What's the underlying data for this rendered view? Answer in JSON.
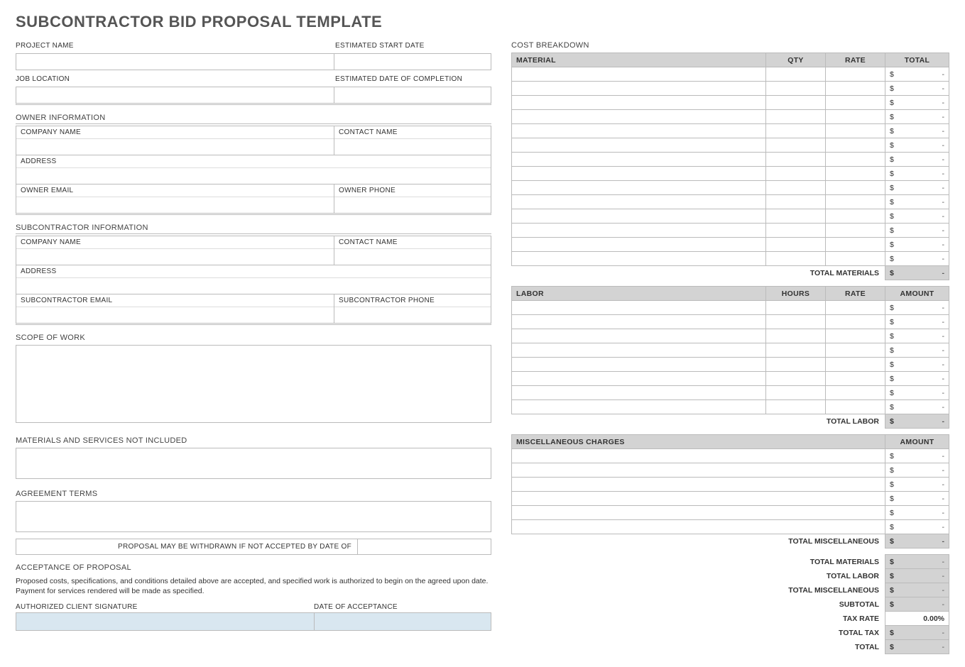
{
  "title": "SUBCONTRACTOR BID PROPOSAL TEMPLATE",
  "left": {
    "project_name_label": "PROJECT NAME",
    "start_date_label": "ESTIMATED START DATE",
    "job_location_label": "JOB LOCATION",
    "completion_label": "ESTIMATED DATE OF COMPLETION",
    "owner_info_label": "OWNER INFORMATION",
    "company_name_label": "COMPANY NAME",
    "contact_name_label": "CONTACT NAME",
    "address_label": "ADDRESS",
    "owner_email_label": "OWNER EMAIL",
    "owner_phone_label": "OWNER PHONE",
    "subcontractor_info_label": "SUBCONTRACTOR INFORMATION",
    "sub_email_label": "SUBCONTRACTOR EMAIL",
    "sub_phone_label": "SUBCONTRACTOR PHONE",
    "scope_label": "SCOPE OF WORK",
    "not_included_label": "MATERIALS AND SERVICES NOT INCLUDED",
    "agreement_label": "AGREEMENT TERMS",
    "proposal_withdraw_label": "PROPOSAL MAY BE WITHDRAWN IF NOT ACCEPTED BY DATE OF",
    "acceptance_label": "ACCEPTANCE OF PROPOSAL",
    "acceptance_text": "Proposed costs, specifications, and conditions detailed above are accepted, and specified work is authorized to begin on the agreed upon date.  Payment for services rendered will be made as specified.",
    "sig_label": "AUTHORIZED CLIENT SIGNATURE",
    "date_accept_label": "DATE OF ACCEPTANCE"
  },
  "right": {
    "cost_breakdown_label": "COST BREAKDOWN",
    "material_header": "MATERIAL",
    "qty_header": "QTY",
    "rate_header": "RATE",
    "total_header": "TOTAL",
    "material_rows": 14,
    "total_materials_label": "TOTAL MATERIALS",
    "labor_header": "LABOR",
    "hours_header": "HOURS",
    "amount_header": "AMOUNT",
    "labor_rows": 8,
    "total_labor_label": "TOTAL LABOR",
    "misc_header": "MISCELLANEOUS CHARGES",
    "misc_rows": 6,
    "total_misc_label": "TOTAL MISCELLANEOUS",
    "summary": {
      "total_materials": "TOTAL MATERIALS",
      "total_labor": "TOTAL LABOR",
      "total_misc": "TOTAL MISCELLANEOUS",
      "subtotal": "SUBTOTAL",
      "tax_rate_label": "TAX RATE",
      "tax_rate_value": "0.00%",
      "total_tax": "TOTAL TAX",
      "total": "TOTAL"
    },
    "currency": "$",
    "dash": "-"
  }
}
